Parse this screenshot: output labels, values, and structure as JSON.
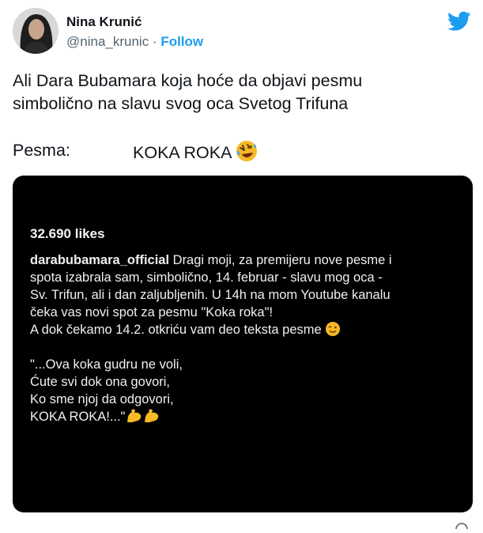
{
  "author": {
    "name": "Nina Krunić",
    "handle": "@nina_krunic",
    "separator": " · ",
    "follow_label": "Follow"
  },
  "tweet": {
    "lines": [
      "Ali Dara Bubamara koja hoće da objavi pesmu",
      "simbolično na slavu svog oca Svetog Trifuna"
    ],
    "pesma_label": "Pesma:",
    "pesma_value": "KOKA ROKA"
  },
  "post_image": {
    "likes": "32.690 likes",
    "username": "darabubamara_official",
    "caption_lines": [
      " Dragi moji, za premijeru nove pesme i",
      "spota izabrala sam, simbolično, 14. februar - slavu mog oca -",
      "Sv. Trifun, ali i dan zaljubljenih. U 14h na mom Youtube kanalu",
      "čeka vas novi spot za pesmu \"Koka roka\"!",
      "A dok čekamo 14.2. otkriću vam deo teksta pesme"
    ],
    "lyrics": [
      "\"...Ova koka gudru ne voli,",
      "Ćute svi dok ona govori,",
      "Ko sme njoj da odgovori,",
      "KOKA ROKA!...\""
    ]
  },
  "icons": {
    "twitter_bird": "twitter-bird-icon",
    "laughing_emoji": "rolling-on-floor-laughing-emoji",
    "wink_emoji": "winking-face-emoji",
    "flexed_biceps": "flexed-biceps-emoji"
  },
  "colors": {
    "accent": "#1d9bf0",
    "text": "#0f1419",
    "muted": "#536471",
    "media_bg": "#000000"
  }
}
